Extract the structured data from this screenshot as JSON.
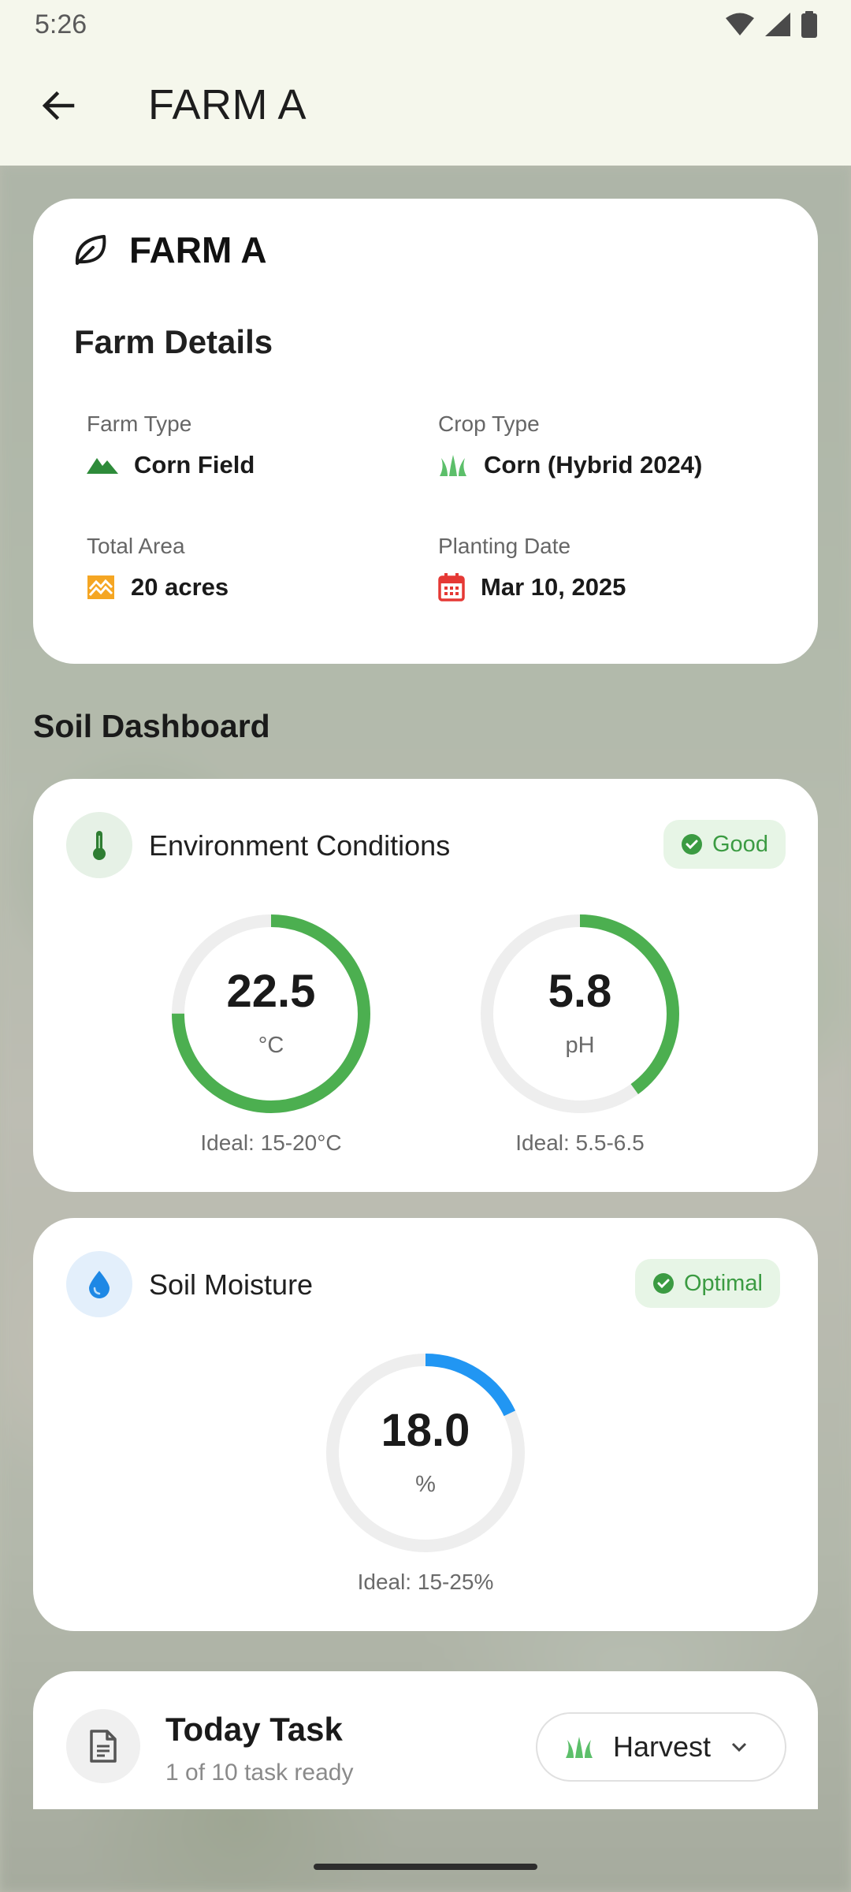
{
  "status_bar": {
    "time": "5:26"
  },
  "app_bar": {
    "title": "FARM A"
  },
  "farm_card": {
    "name": "FARM A",
    "details_title": "Farm Details",
    "farm_type_label": "Farm Type",
    "farm_type_value": "Corn Field",
    "crop_type_label": "Crop Type",
    "crop_type_value": "Corn (Hybrid 2024)",
    "total_area_label": "Total Area",
    "total_area_value": "20 acres",
    "planting_date_label": "Planting Date",
    "planting_date_value": "Mar 10, 2025"
  },
  "section_title": "Soil Dashboard",
  "environment": {
    "title": "Environment Conditions",
    "status": "Good",
    "temperature": {
      "value": "22.5",
      "unit": "°C",
      "ideal": "Ideal: 15-20°C",
      "progress": 0.75
    },
    "ph": {
      "value": "5.8",
      "unit": "pH",
      "ideal": "Ideal: 5.5-6.5",
      "progress": 0.4
    }
  },
  "moisture": {
    "title": "Soil Moisture",
    "status": "Optimal",
    "gauge": {
      "value": "18.0",
      "unit": "%",
      "ideal": "Ideal: 15-25%",
      "progress": 0.18
    }
  },
  "task": {
    "title": "Today Task",
    "subtitle": "1 of 10 task ready",
    "selector_label": "Harvest"
  },
  "colors": {
    "accent_green": "#4caf50",
    "accent_blue": "#2196f3",
    "gauge_track": "#eeeeee",
    "badge_bg": "#e7f5e6"
  }
}
